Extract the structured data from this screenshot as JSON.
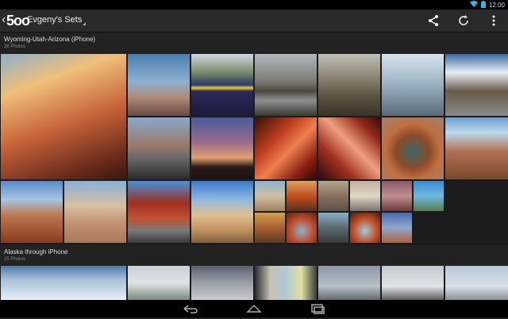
{
  "status": {
    "time": "12:00"
  },
  "actionbar": {
    "logo": "5oo",
    "title": "Evgeny's Sets"
  },
  "sections": [
    {
      "title": "Wyoming-Utah-Arizona (iPhone)",
      "count": "28 Photos"
    },
    {
      "title": "Alaska through iPhone",
      "count": "25 Photos"
    }
  ],
  "icons": [
    "back-icon",
    "share-icon",
    "refresh-icon",
    "overflow-menu-icon",
    "wifi-icon",
    "battery-icon",
    "nav-back-icon",
    "nav-home-icon",
    "nav-recents-icon"
  ]
}
